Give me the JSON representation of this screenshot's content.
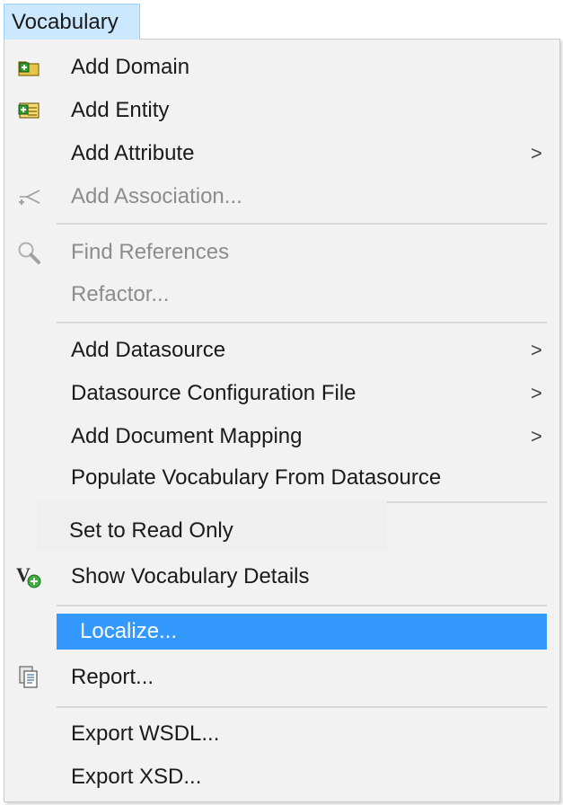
{
  "menubar": {
    "title": "Vocabulary"
  },
  "menu": {
    "items": [
      {
        "label": "Add Domain",
        "icon": "add-domain-icon",
        "enabled": true
      },
      {
        "label": "Add Entity",
        "icon": "add-entity-icon",
        "enabled": true
      },
      {
        "label": "Add Attribute",
        "submenu": true,
        "enabled": true
      },
      {
        "label": "Add Association...",
        "icon": "association-icon",
        "enabled": false
      },
      {
        "label": "Find References",
        "icon": "search-icon",
        "enabled": false
      },
      {
        "label": "Refactor...",
        "enabled": false
      },
      {
        "label": "Add Datasource",
        "submenu": true,
        "enabled": true
      },
      {
        "label": "Datasource Configuration File",
        "submenu": true,
        "enabled": true
      },
      {
        "label": "Add Document Mapping",
        "submenu": true,
        "enabled": true
      },
      {
        "label": "Populate Vocabulary From Datasource",
        "enabled": true
      },
      {
        "label": "Set to Read Only",
        "enabled": true
      },
      {
        "label": "Show Vocabulary Details",
        "icon": "vocabulary-details-icon",
        "enabled": true
      },
      {
        "label": "Localize...",
        "enabled": true,
        "highlighted": true
      },
      {
        "label": "Report...",
        "icon": "report-icon",
        "enabled": true
      },
      {
        "label": "Export WSDL...",
        "enabled": true
      },
      {
        "label": "Export XSD...",
        "enabled": true
      }
    ],
    "submenu_arrow": ">",
    "colors": {
      "highlight": "#3399ff",
      "disabled_text": "#8c8c8c",
      "menu_bg": "#f2f2f2",
      "tab_bg": "#cce8ff"
    }
  }
}
